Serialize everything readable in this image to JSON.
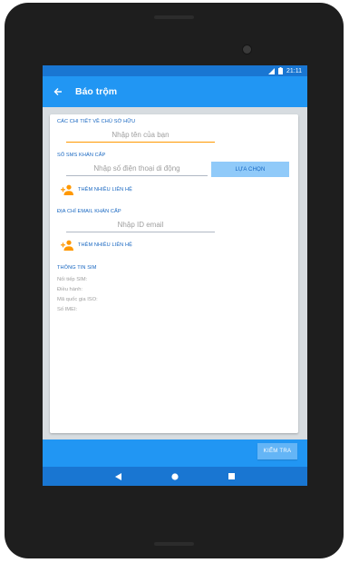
{
  "status_bar": {
    "time": "21:11"
  },
  "app_bar": {
    "title": "Báo trộm"
  },
  "owner_section": {
    "label": "CÁC CHI TIẾT VỀ CHỦ SỞ HỮU",
    "name_placeholder": "Nhập tên của bạn"
  },
  "sms_section": {
    "label": "SỐ SMS KHẨN CẤP",
    "phone_placeholder": "Nhập số điện thoại di động",
    "choose_button": "LỰA CHỌN",
    "add_contact": "THÊM NHIỀU LIÊN HỆ"
  },
  "email_section": {
    "label": "ĐỊA CHỈ EMAIL KHẨN CẤP",
    "email_placeholder": "Nhập ID email",
    "add_contact": "THÊM NHIỀU LIÊN HỆ"
  },
  "sim_info": {
    "label": "THÔNG TIN SIM",
    "rows": [
      "Nối tiếp SIM:",
      "Điều hành:",
      "Mã quốc gia ISO:",
      "Số IMEI:"
    ]
  },
  "footer": {
    "check_button": "KIỂM TRA"
  },
  "colors": {
    "primary": "#2196f3",
    "primary_dark": "#1976d2",
    "accent": "#ff9800",
    "button_light": "#90caf9"
  },
  "icons": {
    "back": "arrow-left-icon",
    "add_contact": "person-add-icon",
    "nav_back": "triangle-back-icon",
    "nav_home": "circle-home-icon",
    "nav_recents": "square-recents-icon"
  }
}
